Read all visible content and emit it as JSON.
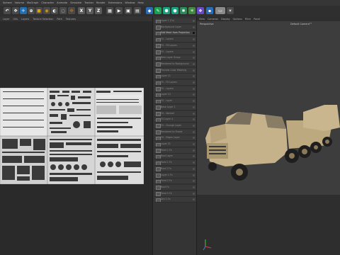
{
  "menubar": {
    "items": [
      "Sphere",
      "Volume",
      "MoGraph",
      "Character",
      "Animate",
      "Simulate",
      "Tracker",
      "Render",
      "Extensions",
      "Window",
      "Help"
    ]
  },
  "toolbar": {
    "axis_labels": [
      "X",
      "Y",
      "Z"
    ]
  },
  "uv_editor": {
    "menu": [
      "Layer",
      "UVs",
      "Layers",
      "Texture Selection",
      "Path",
      "Textures"
    ]
  },
  "layers": {
    "items": [
      "Layer 1 (Fx)",
      "Background Layer",
      "Edit Mesh from Projection",
      "FX - Layers",
      "FX - Fill Layers",
      "FX - Layers",
      "New Layer Group",
      "Rendered to Background",
      "Preview Color Washing",
      "Layer 11",
      "FX - FX Layers",
      "FX - Layers",
      "Layer 13",
      "FX - Layer",
      "Base Layer 1",
      "FX - Normal",
      "FX Layer 4",
      "FX - Grunge Layer",
      "Rendered to Shade",
      "FX - Edges Layer",
      "Layer 21",
      "Paint 1 Fx",
      "Rust Layer",
      "Paint 1 Fx",
      "Rust 2 Fx",
      "Layer 1 Fx",
      "Paint 2 Fx",
      "Rust Fx",
      "Paint 5 Fx",
      "Dirt 2 Fx"
    ],
    "selected_index": 2
  },
  "viewport": {
    "menu": [
      "View",
      "Cameras",
      "Display",
      "Options",
      "Filter",
      "Panel"
    ],
    "label": "Perspective",
    "camera": "Default Camera°°"
  },
  "colors": {
    "accent": "#1f6fb2",
    "truck": "#c8b48c"
  }
}
